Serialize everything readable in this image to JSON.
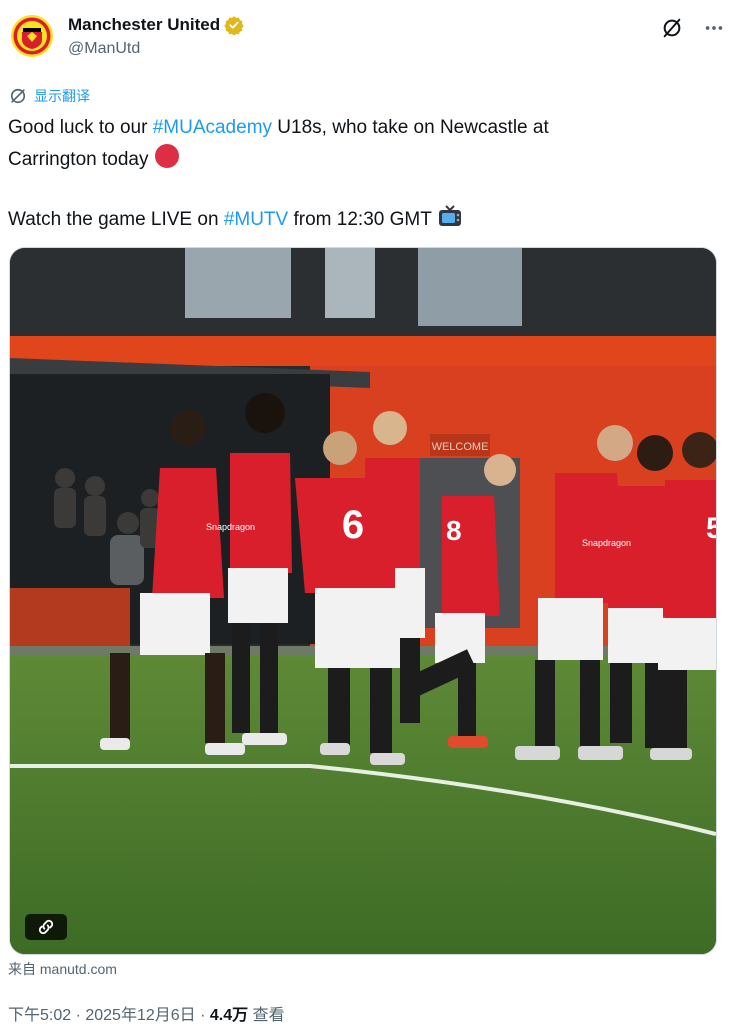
{
  "account": {
    "display_name": "Manchester United",
    "handle": "@ManUtd"
  },
  "translate_label": "显示翻译",
  "tweet": {
    "line1_prefix": "Good luck to our ",
    "hashtag1": "#MUAcademy",
    "line1_suffix": " U18s, who take on Newcastle at",
    "line2": "Carrington today",
    "line3_prefix": "Watch the game LIVE on ",
    "hashtag2": "#MUTV",
    "line3_suffix": " from 12:30 GMT"
  },
  "media": {
    "jersey_numbers": [
      "6",
      "8",
      "5"
    ],
    "sponsor": "Snapdragon",
    "sign_text": "WELCOME"
  },
  "source_label": "来自 manutd.com",
  "meta": {
    "time_date": "下午5:02 · 2025年12月6日 · ",
    "views": "4.4万",
    "views_label": " 查看"
  },
  "colors": {
    "link": "#1d9bf0",
    "secondary_text": "#536471",
    "united_red": "#da1f2c",
    "verified_gold": "#e2b719"
  },
  "icons": [
    "club-crest-icon",
    "verified-badge-icon",
    "grok-icon",
    "more-icon",
    "translate-icon",
    "red-circle-emoji-icon",
    "tv-emoji-icon",
    "link-icon"
  ]
}
